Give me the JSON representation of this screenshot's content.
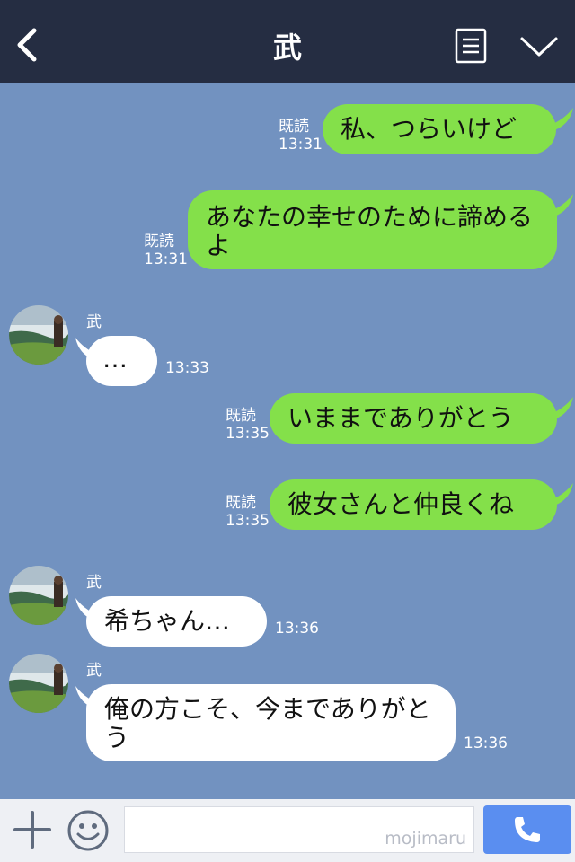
{
  "header": {
    "title": "武"
  },
  "icons": {
    "back": "chevron-left-icon",
    "menu": "menu-list-icon",
    "collapse": "chevron-down-icon",
    "add": "plus-icon",
    "sticker": "smiley-icon",
    "call": "phone-icon"
  },
  "messages": [
    {
      "dir": "out",
      "text": "私、つらいけど",
      "read": "既読",
      "time": "13:31"
    },
    {
      "dir": "out",
      "text": "あなたの幸せのために諦めるよ",
      "read": "既読",
      "time": "13:31"
    },
    {
      "dir": "in",
      "sender": "武",
      "text": "…",
      "time": "13:33"
    },
    {
      "dir": "out",
      "text": "いままでありがとう",
      "read": "既読",
      "time": "13:35"
    },
    {
      "dir": "out",
      "text": "彼女さんと仲良くね",
      "read": "既読",
      "time": "13:35"
    },
    {
      "dir": "in",
      "sender": "武",
      "text": "希ちゃん…",
      "time": "13:36"
    },
    {
      "dir": "in",
      "sender": "武",
      "text": "俺の方こそ、今までありがとう",
      "time": "13:36"
    }
  ],
  "composer": {
    "watermark": "mojimaru"
  },
  "colors": {
    "background": "#7292c0",
    "header": "#252d42",
    "outgoing_bubble": "#84e04a",
    "incoming_bubble": "#ffffff",
    "call_button": "#5a8ef0"
  }
}
